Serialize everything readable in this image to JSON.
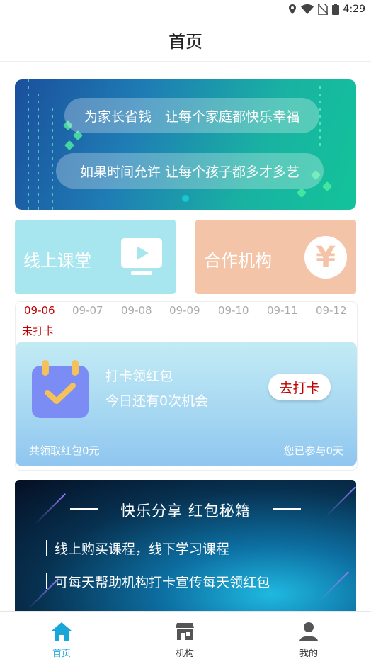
{
  "status_bar": {
    "time": "4:29",
    "icons": [
      "location-icon",
      "wifi-icon",
      "no-sim-icon",
      "battery-icon"
    ]
  },
  "header": {
    "title": "首页"
  },
  "banner": {
    "line1": "为家长省钱　让每个家庭都快乐幸福",
    "line2": "如果时间允许 让每个孩子都多才多艺",
    "slide_count": 1,
    "current_slide": 1
  },
  "quick_cards": {
    "online": "线上课堂",
    "partner": "合作机构"
  },
  "checkin": {
    "dates": [
      "09-06",
      "09-07",
      "09-08",
      "09-09",
      "09-10",
      "09-11",
      "09-12"
    ],
    "active_date_index": 0,
    "status": "未打卡",
    "title": "打卡领红包",
    "subtitle": "今日还有0次机会",
    "button": "去打卡",
    "total": "共领取红包0元",
    "days": "您已参与0天"
  },
  "share": {
    "title": "快乐分享 红包秘籍",
    "items": [
      "线上购买课程，线下学习课程",
      "可每天帮助机构打卡宣传每天领红包"
    ]
  },
  "tabbar": {
    "items": [
      {
        "label": "首页",
        "icon": "home-icon",
        "active": true
      },
      {
        "label": "机构",
        "icon": "store-icon",
        "active": false
      },
      {
        "label": "我的",
        "icon": "user-icon",
        "active": false
      }
    ]
  },
  "colors": {
    "accent": "#1ba6d8",
    "red": "#c00000",
    "online_card": "#a8e6ef",
    "partner_card": "#f4c4a8"
  }
}
